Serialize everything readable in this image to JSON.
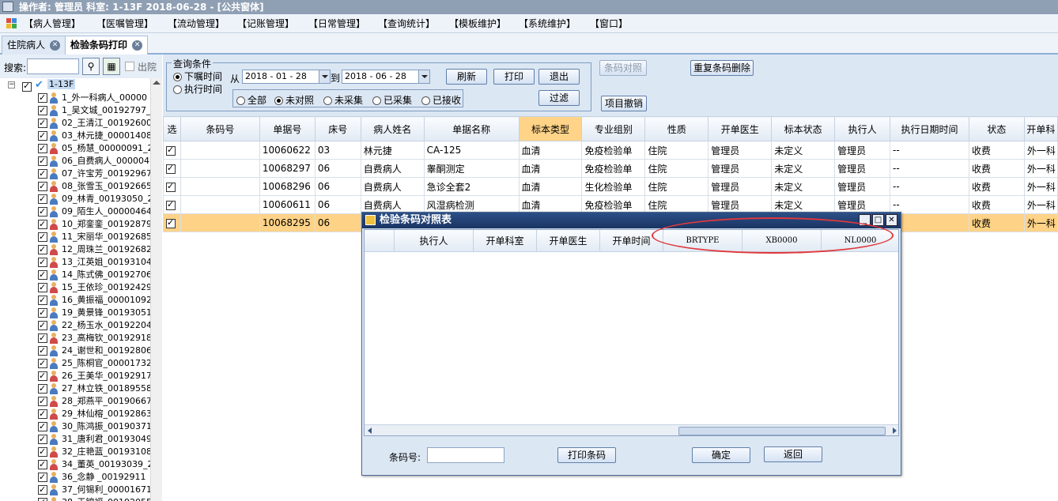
{
  "window": {
    "title": "操作者: 管理员  科室: 1-13F  2018-06-28 - [公共窗体]"
  },
  "menu": [
    "【病人管理】",
    "【医嘱管理】",
    "【流动管理】",
    "【记账管理】",
    "【日常管理】",
    "【查询统计】",
    "【模板维护】",
    "【系统维护】",
    "【窗口】"
  ],
  "tabs": [
    {
      "label": "住院病人",
      "active": false
    },
    {
      "label": "检验条码打印",
      "active": true
    }
  ],
  "left": {
    "search_label": "搜索:",
    "search_value": "",
    "discharged_label": "出院",
    "root_label": "1-13F",
    "patients": [
      {
        "label": "1_外一科病人_00000",
        "f": false
      },
      {
        "label": "1_吴文城_00192797_",
        "f": false
      },
      {
        "label": "02_王清江_00192600",
        "f": false
      },
      {
        "label": "03_林元捷_00001408",
        "f": false
      },
      {
        "label": "05_杨慧_00000091_2",
        "f": true
      },
      {
        "label": "06_自费病人_000004",
        "f": false
      },
      {
        "label": "07_许宝芳_00192967",
        "f": false
      },
      {
        "label": "08_张雪玉_00192665",
        "f": true
      },
      {
        "label": "09_林青_00193050_2",
        "f": false
      },
      {
        "label": "09_陌生人_00000464",
        "f": false
      },
      {
        "label": "10_郑銮銮_00192879",
        "f": true
      },
      {
        "label": "11_宋丽华_00192685",
        "f": false
      },
      {
        "label": "12_周珠兰_00192682",
        "f": true
      },
      {
        "label": "13_江英姐_00193104",
        "f": true
      },
      {
        "label": "14_陈式佛_00192706",
        "f": false
      },
      {
        "label": "15_王依珍_00192429",
        "f": true
      },
      {
        "label": "16_黄振福_00001092",
        "f": false
      },
      {
        "label": "19_黄景锋_00193051",
        "f": false
      },
      {
        "label": "22_杨玉水_00192204",
        "f": false
      },
      {
        "label": "23_高梅钦_00192918",
        "f": true
      },
      {
        "label": "24_谢世和_00192806",
        "f": false
      },
      {
        "label": "25_陈桐官_00001732",
        "f": false
      },
      {
        "label": "26_王美华_00192917",
        "f": true
      },
      {
        "label": "27_林立铁_00189558",
        "f": false
      },
      {
        "label": "28_郑燕平_00190667",
        "f": true
      },
      {
        "label": "29_林仙榕_00192863",
        "f": true
      },
      {
        "label": "30_陈鸿振_00190371",
        "f": false
      },
      {
        "label": "31_唐利君_00193049",
        "f": false
      },
      {
        "label": "32_庄艳蓝_00193108",
        "f": true
      },
      {
        "label": "34_董英_00193039_2",
        "f": true
      },
      {
        "label": "36_念静  _00192911",
        "f": false
      },
      {
        "label": "37_何锡利_00001671",
        "f": false
      },
      {
        "label": "38_王锦福_00192055",
        "f": false
      }
    ]
  },
  "query": {
    "group_label": "查询条件",
    "radio_order_time": "下嘱时间",
    "radio_exec_time": "执行时间",
    "from_label": "从",
    "from_date": "2018 - 01 - 28",
    "to_label": "到",
    "to_date": "2018 - 06 - 28",
    "btn_refresh": "刷新",
    "btn_print": "打印",
    "btn_exit": "退出",
    "btn_filter": "过滤",
    "filters": [
      "全部",
      "未对照",
      "未采集",
      "已采集",
      "已接收"
    ],
    "btn_barcode_compare": "条码对照",
    "btn_repeat_delete": "重复条码删除",
    "btn_item_cancel": "项目撤销"
  },
  "grid": {
    "headers": [
      "选",
      "条码号",
      "单据号",
      "床号",
      "病人姓名",
      "单据名称",
      "标本类型",
      "专业组别",
      "性质",
      "开单医生",
      "标本状态",
      "执行人",
      "执行日期时间",
      "状态",
      "开单科"
    ],
    "rows": [
      [
        "",
        "10060622",
        "03",
        "林元捷",
        "CA-125",
        "血清",
        "免疫检验单",
        "住院",
        "管理员",
        "未定义",
        "管理员",
        "--",
        "收费",
        "外一科"
      ],
      [
        "",
        "10068297",
        "06",
        "自费病人",
        "睾酮测定",
        "血清",
        "免疫检验单",
        "住院",
        "管理员",
        "未定义",
        "管理员",
        "--",
        "收费",
        "外一科"
      ],
      [
        "",
        "10068296",
        "06",
        "自费病人",
        "急诊全套2",
        "血清",
        "生化检验单",
        "住院",
        "管理员",
        "未定义",
        "管理员",
        "--",
        "收费",
        "外一科"
      ],
      [
        "",
        "10060611",
        "06",
        "自费病人",
        "风湿病检测",
        "血清",
        "免疫检验单",
        "住院",
        "管理员",
        "未定义",
        "管理员",
        "--",
        "收费",
        "外一科"
      ],
      [
        "",
        "10068295",
        "06",
        "",
        "",
        "",
        "",
        "",
        "",
        "",
        "",
        "",
        "收费",
        "外一科"
      ]
    ]
  },
  "dialog": {
    "title": "检验条码对照表",
    "headers": [
      "执行人",
      "开单科室",
      "开单医生",
      "开单时间",
      "BRTYPE",
      "XB0000",
      "NL0000"
    ],
    "barcode_label": "条码号:",
    "barcode_value": "",
    "btn_print_barcode": "打印条码",
    "btn_ok": "确定",
    "btn_back": "返回"
  },
  "colors": {
    "accent": "#1a3564",
    "highlight": "#ffd387",
    "annotation": "#e0383c"
  }
}
